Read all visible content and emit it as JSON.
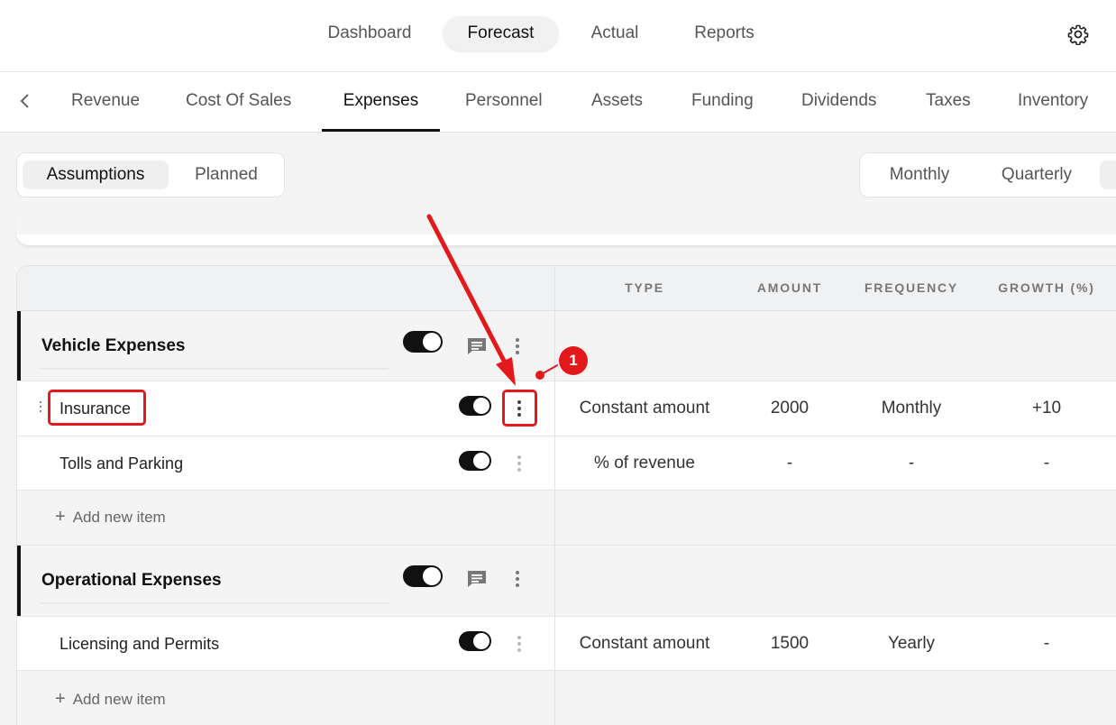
{
  "topnav": {
    "tabs": [
      {
        "label": "Dashboard"
      },
      {
        "label": "Forecast"
      },
      {
        "label": "Actual"
      },
      {
        "label": "Reports"
      }
    ],
    "active": "Forecast"
  },
  "subnav": {
    "tabs": [
      {
        "label": "Revenue"
      },
      {
        "label": "Cost Of Sales"
      },
      {
        "label": "Expenses"
      },
      {
        "label": "Personnel"
      },
      {
        "label": "Assets"
      },
      {
        "label": "Funding"
      },
      {
        "label": "Dividends"
      },
      {
        "label": "Taxes"
      },
      {
        "label": "Inventory"
      }
    ],
    "active": "Expenses"
  },
  "view_toggle": {
    "options": [
      "Assumptions",
      "Planned"
    ],
    "active": "Assumptions"
  },
  "period_toggle": {
    "options": [
      "Monthly",
      "Quarterly"
    ],
    "active": "Monthly"
  },
  "table": {
    "columns": [
      "TYPE",
      "AMOUNT",
      "FREQUENCY",
      "GROWTH (%)"
    ],
    "groups": [
      {
        "name": "Vehicle Expenses",
        "enabled": true,
        "items": [
          {
            "name": "Insurance",
            "enabled": true,
            "type": "Constant amount",
            "amount": "2000",
            "frequency": "Monthly",
            "growth": "+10"
          },
          {
            "name": "Tolls and Parking",
            "enabled": true,
            "type": "% of revenue",
            "amount": "-",
            "frequency": "-",
            "growth": "-"
          }
        ],
        "add_label": "Add new item"
      },
      {
        "name": "Operational Expenses",
        "enabled": true,
        "items": [
          {
            "name": "Licensing and Permits",
            "enabled": true,
            "type": "Constant amount",
            "amount": "1500",
            "frequency": "Yearly",
            "growth": "-"
          }
        ],
        "add_label": "Add new item"
      }
    ]
  },
  "annotation": {
    "step": "1",
    "color": "#e3191c"
  },
  "colors": {
    "accent": "#111111",
    "highlight": "#e3191c",
    "muted": "#555555"
  }
}
